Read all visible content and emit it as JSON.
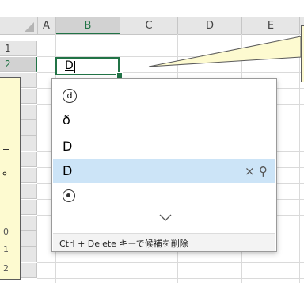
{
  "sheet": {
    "columns": [
      "A",
      "B",
      "C",
      "D",
      "E"
    ],
    "selected_column": "B",
    "rows": [
      "1",
      "2",
      "0",
      "1",
      "2"
    ],
    "selected_row": "2"
  },
  "active_cell": {
    "value": "D"
  },
  "callout_left": {
    "mark": "。",
    "numbers": [
      "0",
      "1",
      "2"
    ]
  },
  "popup": {
    "candidates": [
      {
        "glyph": "d",
        "kind": "circled"
      },
      {
        "glyph": "ð",
        "kind": "text"
      },
      {
        "glyph": "D",
        "kind": "text"
      },
      {
        "glyph": "D",
        "kind": "text",
        "selected": true
      },
      {
        "glyph": "",
        "kind": "bullseye"
      }
    ],
    "delete_icon": "×",
    "search_icon": "⚲",
    "footer_hint": "Ctrl + Delete キーで候補を削除"
  },
  "colors": {
    "excel_green": "#217346",
    "selection_blue": "#cce4f7",
    "comment_yellow": "#fdfad0"
  }
}
